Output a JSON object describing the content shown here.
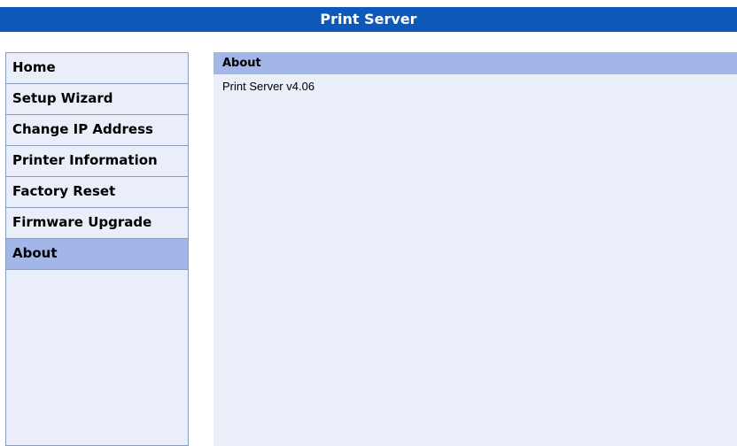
{
  "header": {
    "title": "Print Server"
  },
  "sidebar": {
    "items": [
      {
        "label": "Home"
      },
      {
        "label": "Setup Wizard"
      },
      {
        "label": "Change IP Address"
      },
      {
        "label": "Printer Information"
      },
      {
        "label": "Factory Reset"
      },
      {
        "label": "Firmware Upgrade"
      },
      {
        "label": "About"
      }
    ],
    "active_item": "About"
  },
  "main": {
    "section_title": "About",
    "version_text": "Print Server v4.06"
  },
  "colors": {
    "title_bar": "#0d58b8",
    "panel_background": "#eaeef8",
    "highlight": "#a3b6e9",
    "border": "#8a9dc0"
  }
}
